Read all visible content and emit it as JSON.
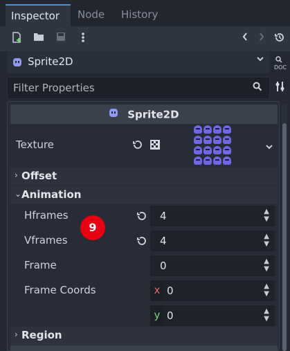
{
  "tabs": [
    {
      "label": "Inspector",
      "active": true
    },
    {
      "label": "Node",
      "active": false
    },
    {
      "label": "History",
      "active": false
    }
  ],
  "toolbar": {
    "icons": [
      "new-script-icon",
      "open-folder-icon",
      "save-icon",
      "more-vertical-icon",
      "back-arrow-icon",
      "forward-arrow-icon",
      "history-icon"
    ]
  },
  "object_selector": {
    "name": "Sprite2D",
    "doc_label": "DOC"
  },
  "filter": {
    "placeholder": "Filter Properties"
  },
  "inspector": {
    "class_header": "Sprite2D",
    "texture": {
      "label": "Texture"
    },
    "sections": {
      "offset": "Offset",
      "animation": "Animation",
      "region": "Region"
    },
    "hframes": {
      "label": "Hframes",
      "value": "4"
    },
    "vframes": {
      "label": "Vframes",
      "value": "4"
    },
    "frame": {
      "label": "Frame",
      "value": "0"
    },
    "frame_coords": {
      "label": "Frame Coords",
      "x_axis": "x",
      "x_value": "0",
      "y_axis": "y",
      "y_value": "0"
    }
  },
  "annotation_badge": "9",
  "colors": {
    "accent": "#4a90e2",
    "badge": "#e60012",
    "axis_x": "#e06c6c",
    "axis_y": "#7fd07f",
    "sprite": "#6f67e4"
  }
}
